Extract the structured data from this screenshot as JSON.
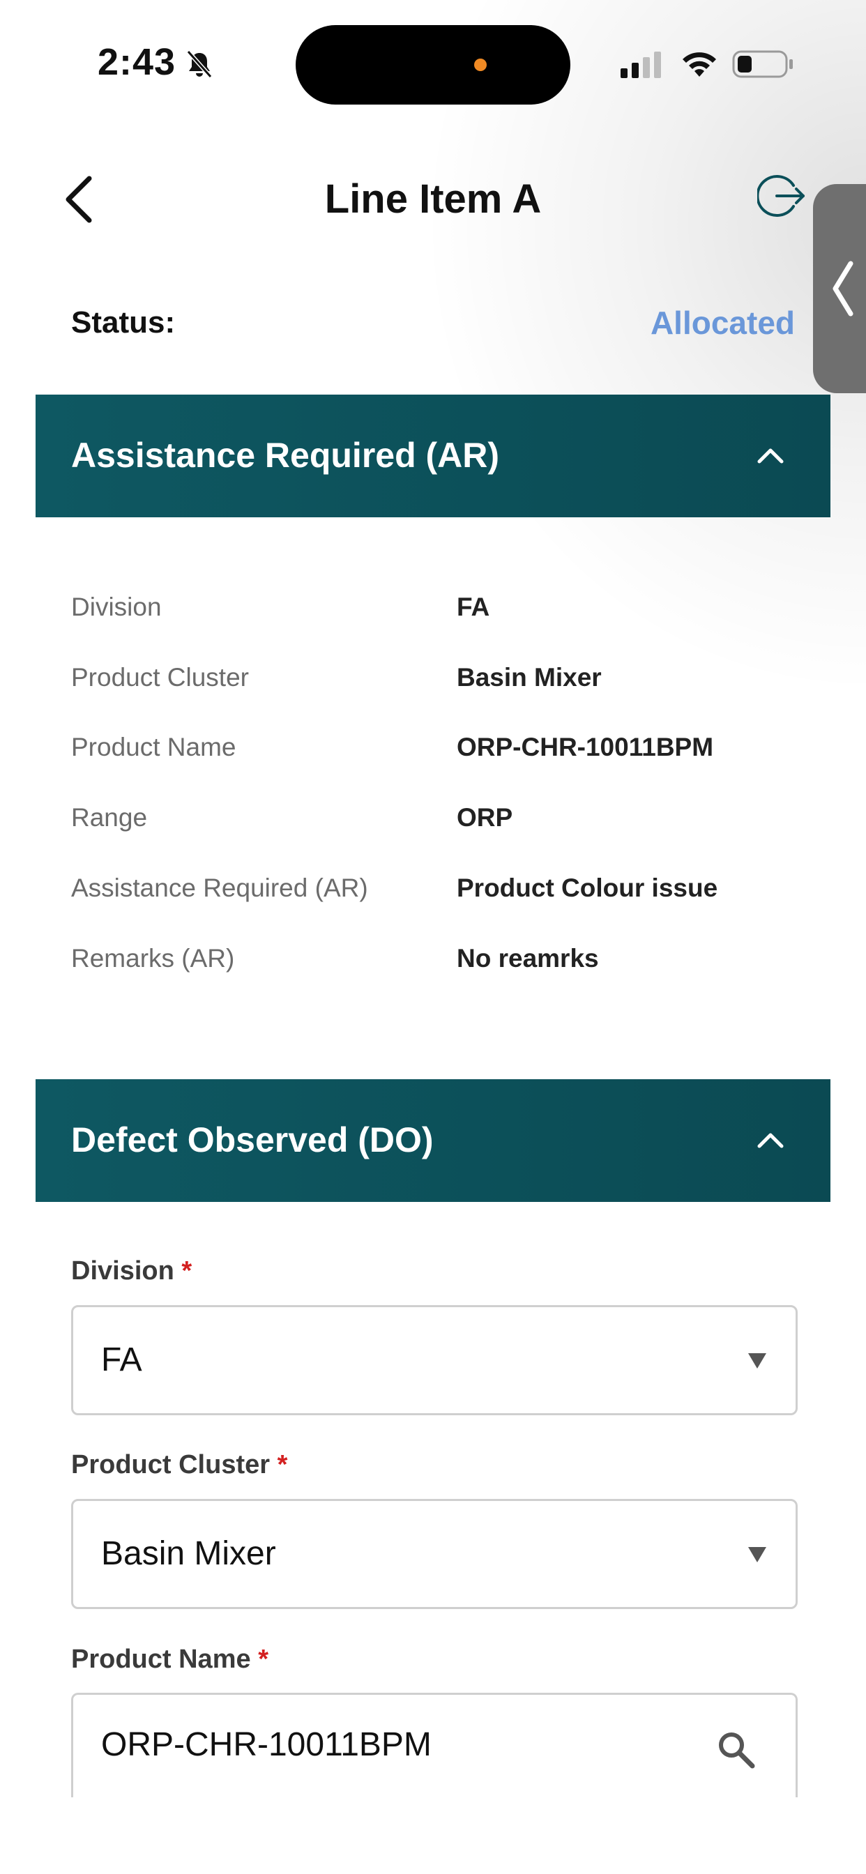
{
  "status_bar": {
    "time": "2:43"
  },
  "header": {
    "title": "Line Item A"
  },
  "status": {
    "label": "Status:",
    "value": "Allocated"
  },
  "colors": {
    "accent": "#0b4f59",
    "status_blue": "#6a97d9",
    "required": "#d32020"
  },
  "icons": {
    "back": "chevron-left-icon",
    "logout": "logout-icon",
    "handle": "chevron-left-icon",
    "collapse": "chevron-up-icon",
    "dropdown": "triangle-down-icon",
    "search": "search-icon"
  },
  "ar_section": {
    "title": "Assistance Required (AR)",
    "rows": [
      {
        "label": "Division",
        "value": "FA"
      },
      {
        "label": "Product Cluster",
        "value": "Basin Mixer"
      },
      {
        "label": "Product Name",
        "value": "ORP-CHR-10011BPM"
      },
      {
        "label": "Range",
        "value": "ORP"
      },
      {
        "label": "Assistance Required (AR)",
        "value": "Product Colour issue"
      },
      {
        "label": "Remarks (AR)",
        "value": "No reamrks"
      }
    ]
  },
  "do_section": {
    "title": "Defect Observed (DO)",
    "required_mark": "*",
    "fields": [
      {
        "label": "Division",
        "value": "FA"
      },
      {
        "label": "Product Cluster",
        "value": "Basin Mixer"
      },
      {
        "label": "Product Name",
        "value": "ORP-CHR-10011BPM"
      }
    ]
  }
}
